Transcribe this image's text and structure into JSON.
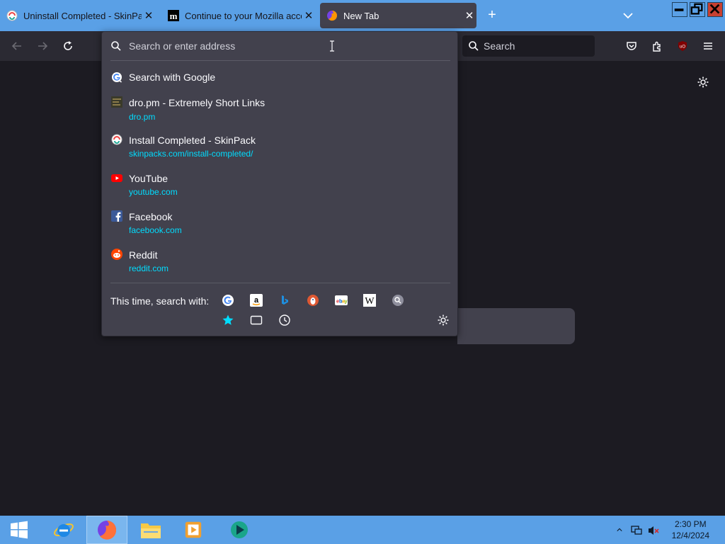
{
  "tabs": [
    {
      "title": "Uninstall Completed - SkinPack",
      "favicon": "skinpack-icon",
      "active": false
    },
    {
      "title": "Continue to your Mozilla accou",
      "favicon": "mozilla-m-icon",
      "active": false
    },
    {
      "title": "New Tab",
      "favicon": "firefox-icon",
      "active": true
    }
  ],
  "tab_close_glyph": "✕",
  "new_tab_glyph": "+",
  "navbar": {
    "search_placeholder": "Search"
  },
  "urlbar": {
    "placeholder": "Search or enter address",
    "results": [
      {
        "title": "Search with Google",
        "url": "",
        "icon": "google-icon"
      },
      {
        "title": "dro.pm - Extremely Short Links",
        "url": "dro.pm",
        "icon": "dropm-icon"
      },
      {
        "title": "Install Completed - SkinPack",
        "url": "skinpacks.com/install-completed/",
        "icon": "skinpack-icon"
      },
      {
        "title": "YouTube",
        "url": "youtube.com",
        "icon": "youtube-icon"
      },
      {
        "title": "Facebook",
        "url": "facebook.com",
        "icon": "facebook-icon"
      },
      {
        "title": "Reddit",
        "url": "reddit.com",
        "icon": "reddit-icon"
      }
    ],
    "oneoff_label": "This time, search with:",
    "engines": [
      "google-icon",
      "amazon-icon",
      "bing-icon",
      "duckduckgo-icon",
      "ebay-icon",
      "wikipedia-icon",
      "search-engine-icon"
    ],
    "modes": [
      "bookmarks-star-icon",
      "tabs-icon",
      "history-icon"
    ]
  },
  "taskbar": {
    "time": "2:30 PM",
    "date": "12/4/2024"
  },
  "colors": {
    "accent": "#5aa0e6",
    "url_link": "#00ddff",
    "popup_bg": "#42414d",
    "toolbar_bg": "#2b2a33",
    "page_bg": "#1c1b22"
  }
}
